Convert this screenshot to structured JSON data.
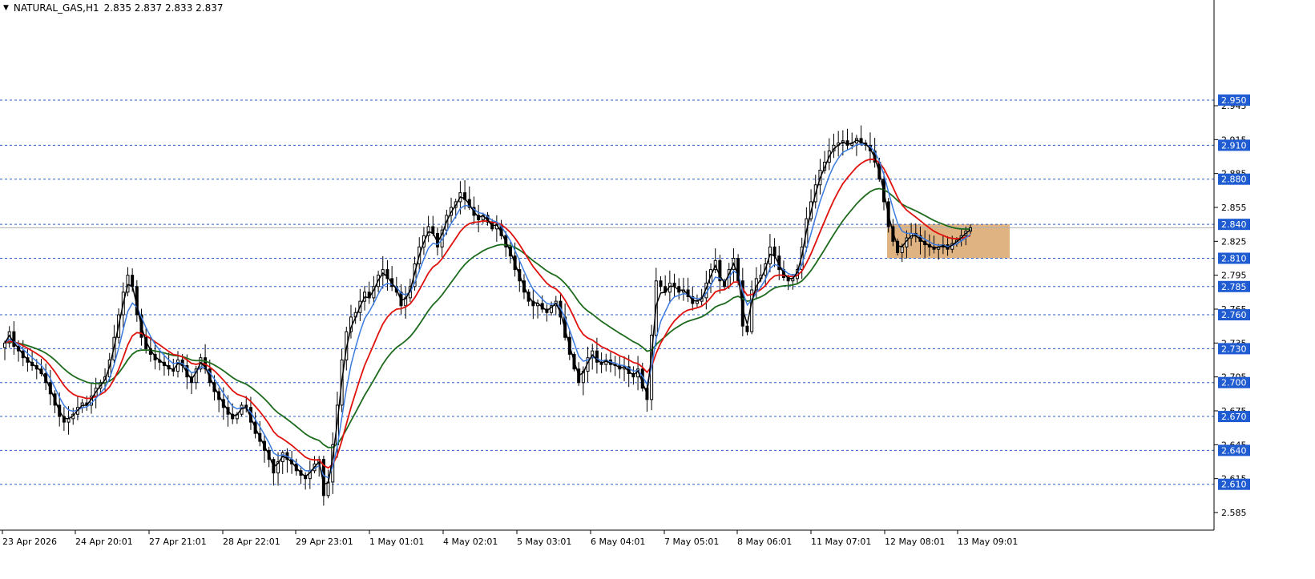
{
  "header": {
    "symbol": "NATURAL_GAS,H1",
    "ohlc": "2.835 2.837 2.833 2.837",
    "menu_icon": "triangle-down-icon"
  },
  "colors": {
    "background": "#ffffff",
    "candle": "#000000",
    "grid_dash": "#2b5fc9",
    "label_bg": "#1f5bd1",
    "label_text": "#ffffff",
    "ma_fast": "#000000",
    "ma_mid": "#3b7be0",
    "ma_slow": "#e0120d",
    "ma_long": "#1e6b1e",
    "zone_fill": "#d9a66c"
  },
  "chart_data": {
    "type": "candlestick",
    "y_range": [
      2.575,
      2.955
    ],
    "ticks": [
      "2.945",
      "2.915",
      "2.885",
      "2.855",
      "2.825",
      "2.795",
      "2.765",
      "2.735",
      "2.705",
      "2.675",
      "2.645",
      "2.615",
      "2.585"
    ],
    "levels": [
      "2.950",
      "2.910",
      "2.880",
      "2.840",
      "2.810",
      "2.785",
      "2.760",
      "2.730",
      "2.700",
      "2.670",
      "2.640",
      "2.610"
    ],
    "current_price": "2.837",
    "x_labels": [
      "23 Apr 2026",
      "24 Apr 20:01",
      "27 Apr 21:01",
      "28 Apr 22:01",
      "29 Apr 23:01",
      "1 May 01:01",
      "4 May 02:01",
      "5 May 03:01",
      "6 May 04:01",
      "7 May 05:01",
      "8 May 06:01",
      "11 May 07:01",
      "12 May 08:01",
      "13 May 09:01"
    ],
    "zone": {
      "low": 2.81,
      "high": 2.84
    },
    "closes": [
      2.735,
      2.745,
      2.732,
      2.728,
      2.722,
      2.718,
      2.715,
      2.712,
      2.708,
      2.7,
      2.69,
      2.68,
      2.67,
      2.665,
      2.668,
      2.672,
      2.678,
      2.682,
      2.68,
      2.688,
      2.695,
      2.7,
      2.705,
      2.72,
      2.74,
      2.76,
      2.78,
      2.795,
      2.785,
      2.76,
      2.74,
      2.73,
      2.725,
      2.72,
      2.718,
      2.715,
      2.712,
      2.71,
      2.72,
      2.715,
      2.705,
      2.7,
      2.712,
      2.722,
      2.712,
      2.7,
      2.692,
      2.685,
      2.678,
      2.672,
      2.668,
      2.672,
      2.68,
      2.678,
      2.665,
      2.655,
      2.648,
      2.64,
      2.632,
      2.62,
      2.63,
      2.638,
      2.632,
      2.628,
      2.622,
      2.618,
      2.615,
      2.622,
      2.628,
      2.632,
      2.6,
      2.612,
      2.645,
      2.68,
      2.72,
      2.745,
      2.758,
      2.762,
      2.772,
      2.78,
      2.775,
      2.785,
      2.795,
      2.8,
      2.792,
      2.785,
      2.78,
      2.768,
      2.775,
      2.785,
      2.805,
      2.82,
      2.83,
      2.838,
      2.832,
      2.82,
      2.835,
      2.848,
      2.855,
      2.86,
      2.868,
      2.862,
      2.855,
      2.848,
      2.844,
      2.848,
      2.842,
      2.836,
      2.84,
      2.83,
      2.82,
      2.812,
      2.8,
      2.79,
      2.78,
      2.772,
      2.768,
      2.77,
      2.765,
      2.762,
      2.768,
      2.772,
      2.758,
      2.74,
      2.725,
      2.712,
      2.7,
      2.71,
      2.722,
      2.728,
      2.718,
      2.716,
      2.72,
      2.716,
      2.715,
      2.712,
      2.714,
      2.708,
      2.705,
      2.712,
      2.695,
      2.685,
      2.742,
      2.79,
      2.785,
      2.78,
      2.788,
      2.785,
      2.78,
      2.782,
      2.776,
      2.77,
      2.772,
      2.775,
      2.788,
      2.8,
      2.808,
      2.79,
      2.785,
      2.8,
      2.81,
      2.79,
      2.75,
      2.745,
      2.782,
      2.792,
      2.795,
      2.805,
      2.82,
      2.812,
      2.8,
      2.793,
      2.79,
      2.792,
      2.8,
      2.82,
      2.845,
      2.86,
      2.875,
      2.888,
      2.895,
      2.905,
      2.91,
      2.912,
      2.914,
      2.91,
      2.912,
      2.916,
      2.912,
      2.91,
      2.905,
      2.895,
      2.88,
      2.86,
      2.838,
      2.825,
      2.815,
      2.82,
      2.828,
      2.832,
      2.83,
      2.825,
      2.822,
      2.82,
      2.818,
      2.82,
      2.822,
      2.818,
      2.823,
      2.826,
      2.83,
      2.834,
      2.837
    ]
  }
}
